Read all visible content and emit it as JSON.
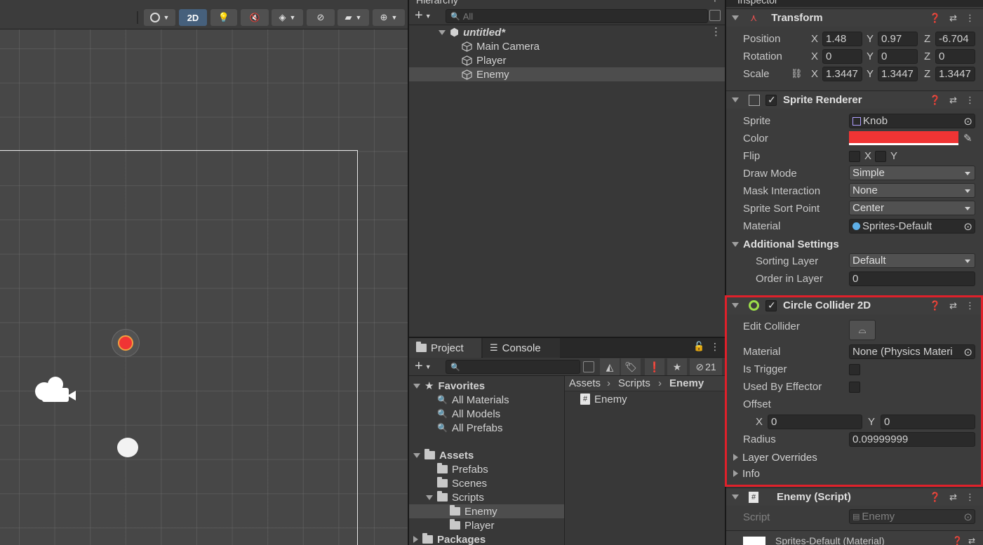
{
  "scene": {
    "toolbar": {
      "mode_2d_label": "2D"
    }
  },
  "hierarchy": {
    "tab_label": "Hierarchy",
    "search_placeholder": "All",
    "scene_name": "untitled*",
    "items": [
      {
        "label": "Main Camera"
      },
      {
        "label": "Player"
      },
      {
        "label": "Enemy"
      }
    ]
  },
  "project": {
    "tabs": [
      {
        "label": "Project"
      },
      {
        "label": "Console"
      }
    ],
    "hidden_count": "21",
    "favorites_label": "Favorites",
    "favorites": [
      "All Materials",
      "All Models",
      "All Prefabs"
    ],
    "assets_label": "Assets",
    "asset_folders": [
      "Prefabs",
      "Scenes",
      "Scripts"
    ],
    "script_folders": [
      "Enemy",
      "Player"
    ],
    "packages_label": "Packages",
    "breadcrumb": [
      "Assets",
      "Scripts",
      "Enemy"
    ],
    "files": [
      "Enemy"
    ]
  },
  "inspector": {
    "tab_label": "Inspector",
    "transform": {
      "title": "Transform",
      "position_label": "Position",
      "rotation_label": "Rotation",
      "scale_label": "Scale",
      "axis_x": "X",
      "axis_y": "Y",
      "axis_z": "Z",
      "position": [
        "1.48",
        "0.97",
        "-6.704"
      ],
      "rotation": [
        "0",
        "0",
        "0"
      ],
      "scale": [
        "1.3447",
        "1.3447",
        "1.3447"
      ]
    },
    "sprite_renderer": {
      "title": "Sprite Renderer",
      "sprite_label": "Sprite",
      "sprite_value": "Knob",
      "color_label": "Color",
      "color_value": "#f03434",
      "flip_label": "Flip",
      "flip_x": "X",
      "flip_y": "Y",
      "draw_mode_label": "Draw Mode",
      "draw_mode_value": "Simple",
      "mask_label": "Mask Interaction",
      "mask_value": "None",
      "sort_point_label": "Sprite Sort Point",
      "sort_point_value": "Center",
      "material_label": "Material",
      "material_value": "Sprites-Default",
      "additional_label": "Additional Settings",
      "sorting_layer_label": "Sorting Layer",
      "sorting_layer_value": "Default",
      "order_label": "Order in Layer",
      "order_value": "0"
    },
    "circle_collider": {
      "title": "Circle Collider 2D",
      "edit_label": "Edit Collider",
      "material_label": "Material",
      "material_value": "None (Physics Materi",
      "trigger_label": "Is Trigger",
      "effector_label": "Used By Effector",
      "offset_label": "Offset",
      "offset_x_label": "X",
      "offset_x": "0",
      "offset_y_label": "Y",
      "offset_y": "0",
      "radius_label": "Radius",
      "radius_value": "0.09999999",
      "layer_overrides_label": "Layer Overrides",
      "info_label": "Info"
    },
    "enemy_script": {
      "title": "Enemy (Script)",
      "script_label": "Script",
      "script_value": "Enemy"
    },
    "material_footer": "Sprites-Default (Material)"
  },
  "colors": {
    "accent": "#46607c",
    "highlight": "#e0202a",
    "sprite_color": "#f03434"
  }
}
